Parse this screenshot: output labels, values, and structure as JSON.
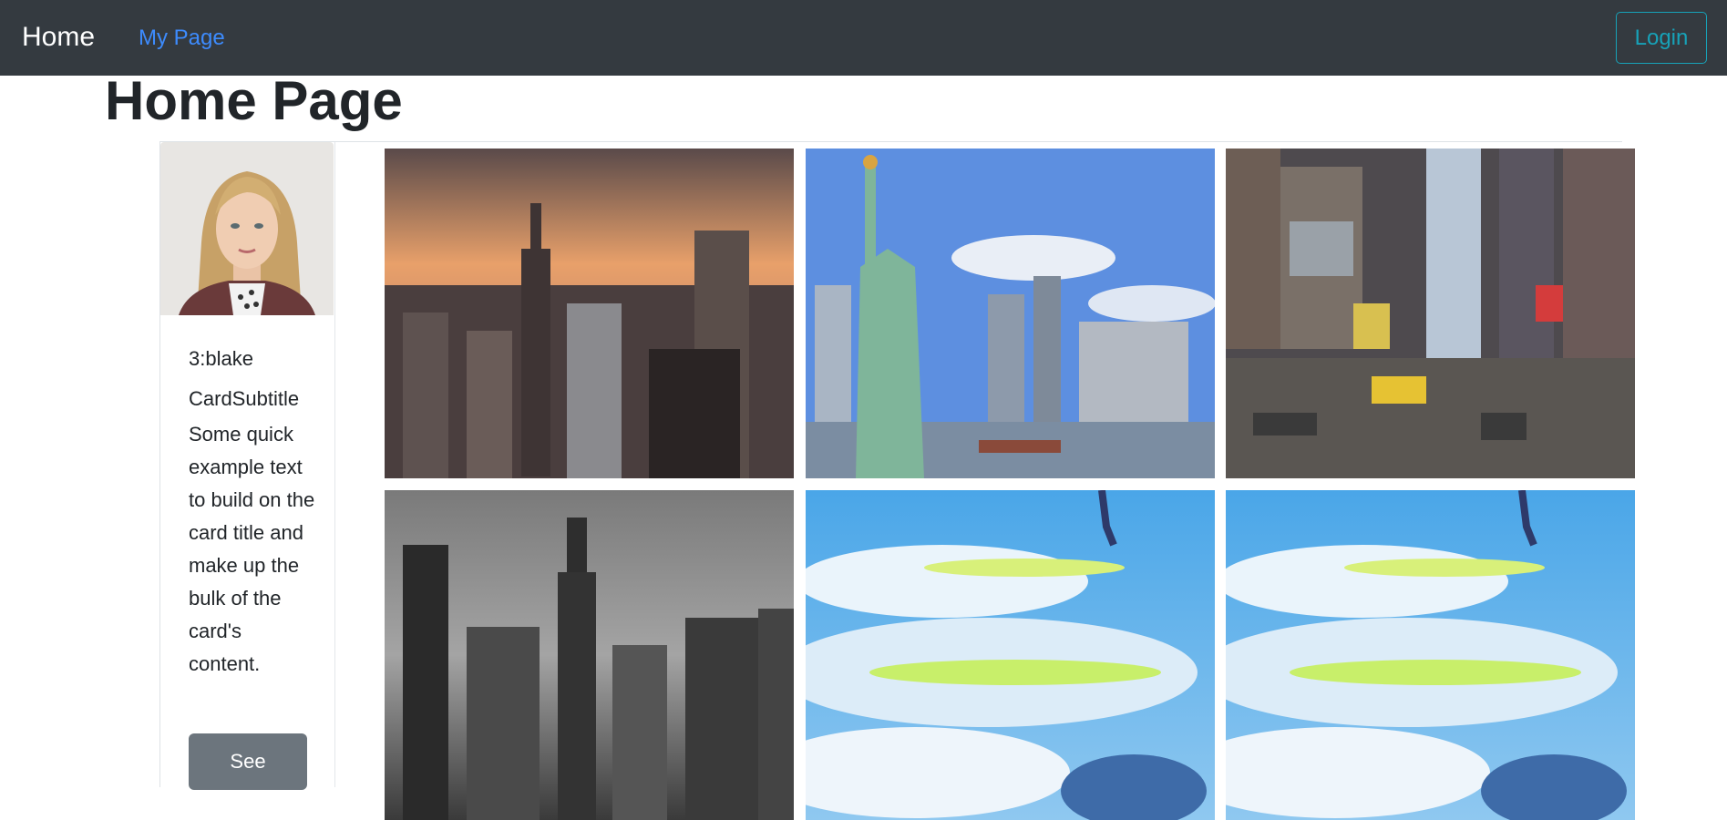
{
  "nav": {
    "brand": "Home",
    "my_page": "My Page",
    "login": "Login"
  },
  "page": {
    "title": "Home Page"
  },
  "profile": {
    "title": "3:blake",
    "subtitle": "CardSubtitle",
    "text": "Some quick example text to build on the card title and make up the bulk of the card's content.",
    "button": "See"
  },
  "gallery": [
    {
      "subject": "city skyline at sunset"
    },
    {
      "subject": "statue of liberty"
    },
    {
      "subject": "times square street"
    },
    {
      "subject": "black and white skyline"
    },
    {
      "subject": "anime sky with clouds"
    },
    {
      "subject": "anime sky with clouds"
    }
  ],
  "colors": {
    "navbar": "#343a40",
    "link": "#3d8bfd",
    "login_outline": "#17a2b8",
    "button_secondary": "#6c757d"
  }
}
